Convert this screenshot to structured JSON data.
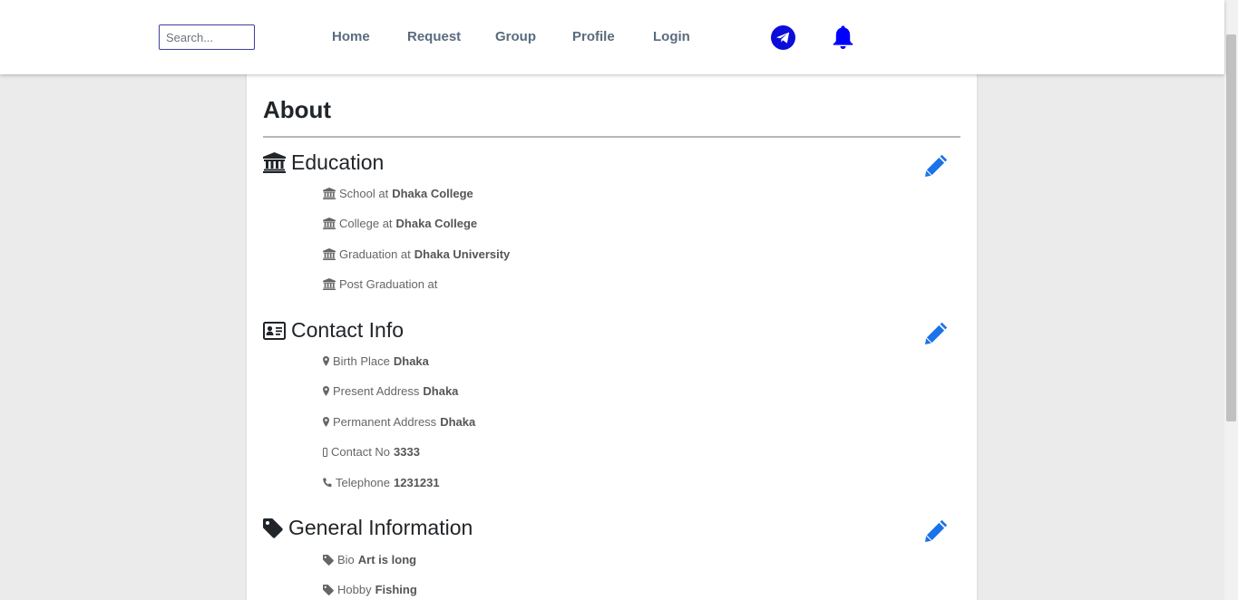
{
  "nav": {
    "search_placeholder": "Search...",
    "links": [
      "Home",
      "Request",
      "Group",
      "Profile",
      "Login"
    ],
    "icons": [
      "telegram-icon",
      "bell-icon"
    ]
  },
  "about": {
    "title": "About",
    "edit_icon": "pencil-icon",
    "education": {
      "heading": "Education",
      "icon": "university-icon",
      "items": [
        {
          "label": "School at",
          "value": "Dhaka College"
        },
        {
          "label": "College at",
          "value": "Dhaka College"
        },
        {
          "label": "Graduation at",
          "value": "Dhaka University"
        },
        {
          "label": "Post Graduation at",
          "value": ""
        }
      ]
    },
    "contact": {
      "heading": "Contact Info",
      "icon": "address-card-icon",
      "items": [
        {
          "label": "Birth Place",
          "value": "Dhaka",
          "icon": "map-marker-icon"
        },
        {
          "label": "Present Address",
          "value": "Dhaka",
          "icon": "map-marker-icon"
        },
        {
          "label": "Permanent Address",
          "value": "Dhaka",
          "icon": "map-marker-icon"
        },
        {
          "label": "Contact No",
          "value": "3333",
          "icon": "mobile-icon"
        },
        {
          "label": "Telephone",
          "value": "1231231",
          "icon": "phone-icon"
        }
      ]
    },
    "general": {
      "heading": "General Information",
      "icon": "tag-icon",
      "items": [
        {
          "label": "Bio",
          "value": "Art is long",
          "icon": "tag-icon"
        },
        {
          "label": "Hobby",
          "value": "Fishing",
          "icon": "tag-icon"
        }
      ]
    }
  },
  "colors": {
    "accent": "#1a73e8",
    "bell": "#0000ff",
    "telegram": "#0d0dd9",
    "nav_text": "#5a6b7d",
    "background": "#ebebeb"
  }
}
